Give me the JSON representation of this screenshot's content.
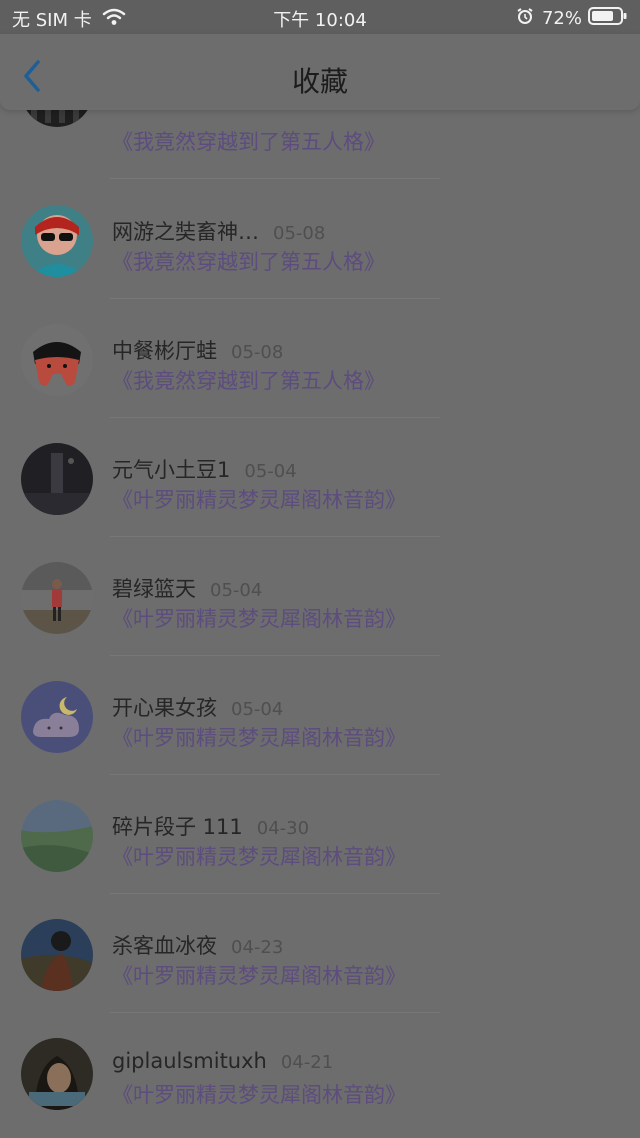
{
  "status_bar": {
    "carrier": "无 SIM 卡",
    "time": "下午 10:04",
    "battery": "72%",
    "icons": [
      "wifi-icon",
      "alarm-icon",
      "battery-icon"
    ]
  },
  "nav": {
    "title": "收藏",
    "back_icon": "chevron-left-icon",
    "accent": "#1f6fb0"
  },
  "items": [
    {
      "name": "",
      "date": "",
      "title": "《我竟然穿越到了第五人格》",
      "avatar": "dark-gate"
    },
    {
      "name": "网游之奘畜神…",
      "date": "05-08",
      "title": "《我竟然穿越到了第五人格》",
      "avatar": "red-sunglasses"
    },
    {
      "name": "中餐彬厅蛙",
      "date": "05-08",
      "title": "《我竟然穿越到了第五人格》",
      "avatar": "cartoon-tooth"
    },
    {
      "name": "元气小土豆1",
      "date": "05-04",
      "title": "《叶罗丽精灵梦灵犀阁林音韵》",
      "avatar": "dark-night"
    },
    {
      "name": "碧绿篮天",
      "date": "05-04",
      "title": "《叶罗丽精灵梦灵犀阁林音韵》",
      "avatar": "person-standing"
    },
    {
      "name": "开心果女孩",
      "date": "05-04",
      "title": "《叶罗丽精灵梦灵犀阁林音韵》",
      "avatar": "cloud-moon"
    },
    {
      "name": "碎片段子 111",
      "date": "04-30",
      "title": "《叶罗丽精灵梦灵犀阁林音韵》",
      "avatar": "landscape-sky"
    },
    {
      "name": "杀客血冰夜",
      "date": "04-23",
      "title": "《叶罗丽精灵梦灵犀阁林音韵》",
      "avatar": "sunset-figure"
    },
    {
      "name": "giplaulsmituxh",
      "date": "04-21",
      "title": "《叶罗丽精灵梦灵犀阁林音韵》",
      "avatar": "girl-portrait"
    }
  ]
}
